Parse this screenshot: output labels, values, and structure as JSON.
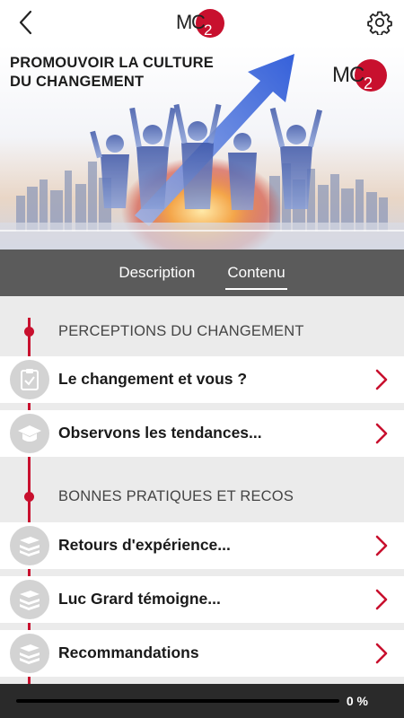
{
  "header": {
    "back_icon": "chevron-left-icon",
    "logo_text_left": "M",
    "logo_text_right": "C",
    "logo_sub": "2",
    "settings_icon": "gear-icon"
  },
  "hero": {
    "title_line1": "PROMOUVOIR LA CULTURE",
    "title_line2": "DU CHANGEMENT",
    "logo_text_left": "M",
    "logo_text_right": "C",
    "logo_sub": "2"
  },
  "tabs": [
    {
      "label": "Description",
      "active": false
    },
    {
      "label": "Contenu",
      "active": true
    }
  ],
  "sections": [
    {
      "title": "PERCEPTIONS DU CHANGEMENT",
      "items": [
        {
          "label": "Le changement et vous ?",
          "icon": "clipboard-check-icon"
        },
        {
          "label": "Observons les tendances...",
          "icon": "graduation-cap-icon"
        }
      ]
    },
    {
      "title": "BONNES PRATIQUES ET RECOS",
      "items": [
        {
          "label": "Retours d'expérience...",
          "icon": "books-icon"
        },
        {
          "label": "Luc Grard témoigne...",
          "icon": "books-icon"
        },
        {
          "label": "Recommandations",
          "icon": "books-icon"
        }
      ]
    }
  ],
  "progress": {
    "value": 0,
    "label": "0 %"
  },
  "colors": {
    "accent": "#c8102e",
    "tabs_bg": "#5b5b5b",
    "list_bg": "#ebebeb",
    "bottom_bg": "#2a2a2a"
  }
}
